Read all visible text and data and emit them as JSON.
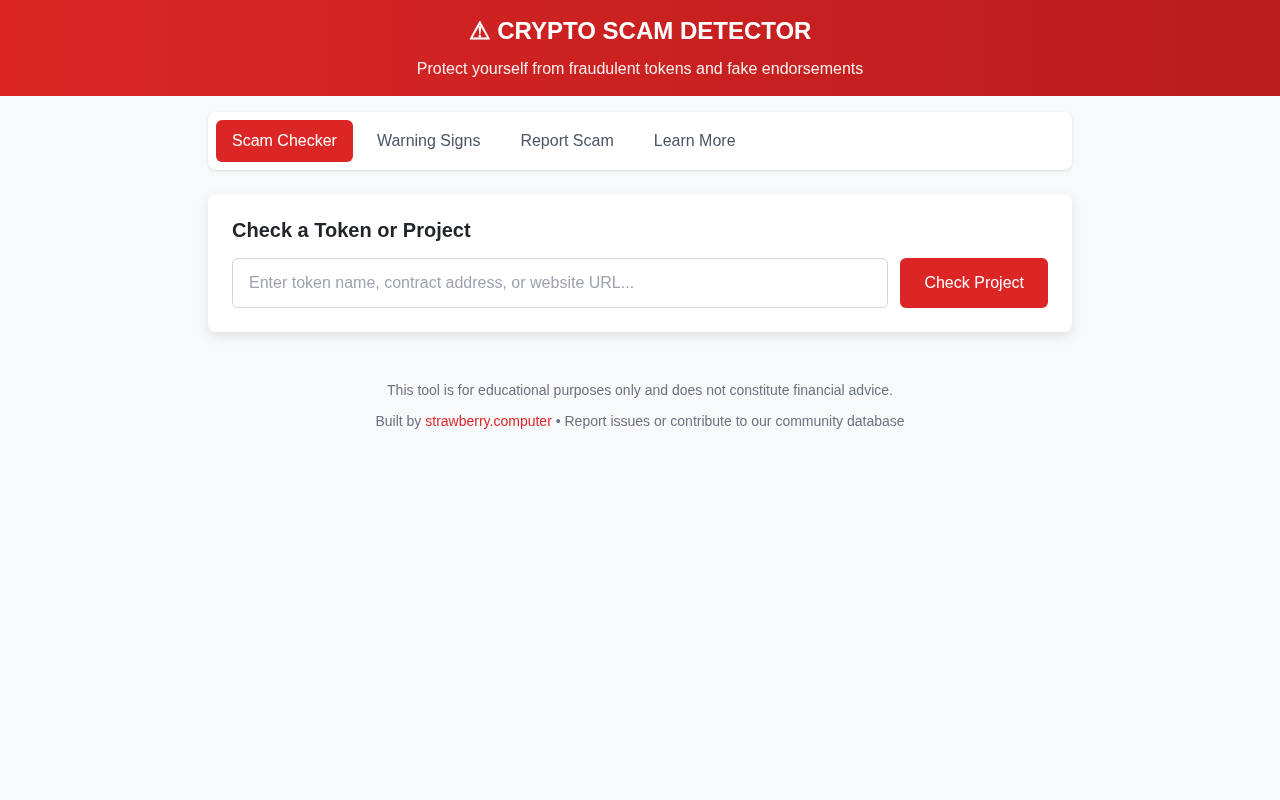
{
  "header": {
    "title": "⚠ CRYPTO SCAM DETECTOR",
    "subtitle": "Protect yourself from fraudulent tokens and fake endorsements"
  },
  "tabs": [
    {
      "label": "Scam Checker",
      "selected": true
    },
    {
      "label": "Warning Signs",
      "selected": false
    },
    {
      "label": "Report Scam",
      "selected": false
    },
    {
      "label": "Learn More",
      "selected": false
    }
  ],
  "checker": {
    "heading": "Check a Token or Project",
    "placeholder": "Enter token name, contract address, or website URL...",
    "button": "Check Project"
  },
  "footer": {
    "disclaimer": "This tool is for educational purposes only and does not constitute financial advice.",
    "credit_prefix": "Built by",
    "credit_link": "strawberry.computer",
    "credit_suffix": "• Report issues or contribute to our community database"
  }
}
